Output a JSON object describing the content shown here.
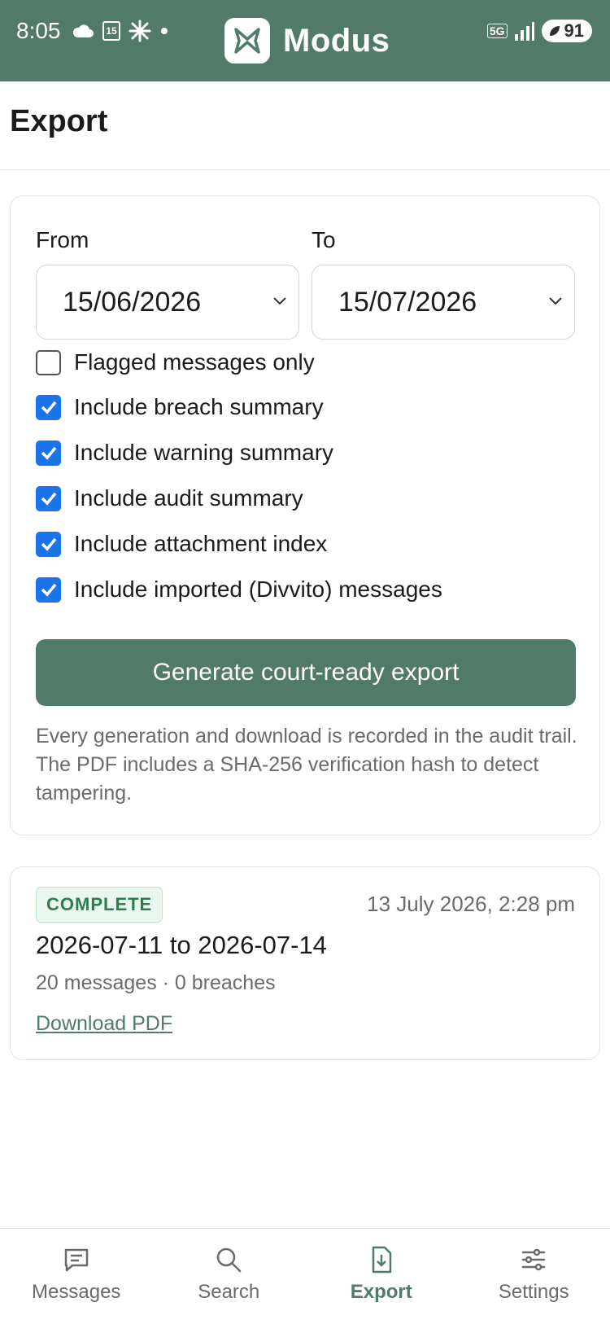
{
  "status_bar": {
    "time": "8:05",
    "calendar_day": "15",
    "network": "5G",
    "battery": "91"
  },
  "app": {
    "name": "Modus",
    "accent_color": "#527a68"
  },
  "page": {
    "title": "Export"
  },
  "form": {
    "from_label": "From",
    "to_label": "To",
    "from_value": "15/06/2026",
    "to_value": "15/07/2026",
    "options": [
      {
        "label": "Flagged messages only",
        "checked": false
      },
      {
        "label": "Include breach summary",
        "checked": true
      },
      {
        "label": "Include warning summary",
        "checked": true
      },
      {
        "label": "Include audit summary",
        "checked": true
      },
      {
        "label": "Include attachment index",
        "checked": true
      },
      {
        "label": "Include imported (Divvito) messages",
        "checked": true
      }
    ],
    "generate_button": "Generate court-ready export",
    "note": "Every generation and download is recorded in the audit trail. The PDF includes a SHA-256 verification hash to detect tampering."
  },
  "exports": [
    {
      "status": "COMPLETE",
      "created": "13 July 2026, 2:28 pm",
      "range": "2026-07-11 to 2026-07-14",
      "summary": "20 messages · 0 breaches",
      "download_label": "Download PDF"
    }
  ],
  "nav": {
    "items": [
      {
        "label": "Messages",
        "icon": "message-icon",
        "active": false
      },
      {
        "label": "Search",
        "icon": "search-icon",
        "active": false
      },
      {
        "label": "Export",
        "icon": "file-download-icon",
        "active": true
      },
      {
        "label": "Settings",
        "icon": "sliders-icon",
        "active": false
      }
    ]
  }
}
